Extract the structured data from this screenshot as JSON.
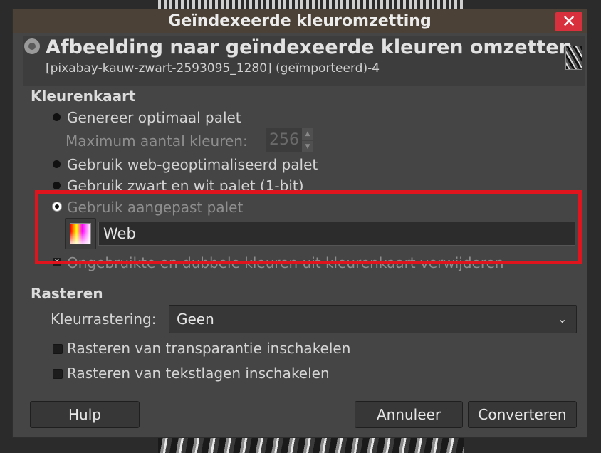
{
  "window": {
    "title": "Geïndexeerde kleuromzetting",
    "close_label": "✕"
  },
  "header": {
    "title": "Afbeelding naar geïndexeerde kleuren omzetten",
    "subtitle": "[pixabay-kauw-zwart-2593095_1280] (geïmporteerd)-4"
  },
  "colormap": {
    "section_label": "Kleurenkaart",
    "options": [
      {
        "label": "Genereer optimaal palet",
        "selected": false
      },
      {
        "label": "Gebruik web-geoptimaliseerd palet",
        "selected": false
      },
      {
        "label": "Gebruik zwart en wit palet (1-bit)",
        "selected": false
      },
      {
        "label": "Gebruik aangepast palet",
        "selected": true
      }
    ],
    "max_colors_label": "Maximum aantal kleuren:",
    "max_colors_value": "256",
    "palette_name": "Web",
    "remove_unused_label": "Ongebruikte en dubbele kleuren uit kleurenkaart verwijderen",
    "remove_unused_checked": true
  },
  "dithering": {
    "section_label": "Rasteren",
    "color_dither_label": "Kleurrastering:",
    "color_dither_value": "Geen",
    "options": [
      {
        "label": "Rasteren van transparantie inschakelen",
        "checked": false
      },
      {
        "label": "Rasteren van tekstlagen inschakelen",
        "checked": false
      }
    ]
  },
  "buttons": {
    "help": "Hulp",
    "cancel": "Annuleer",
    "convert": "Converteren"
  },
  "colors": {
    "highlight": "#e0141c",
    "close_button": "#d9303d",
    "titlebar": "#4c4136"
  }
}
